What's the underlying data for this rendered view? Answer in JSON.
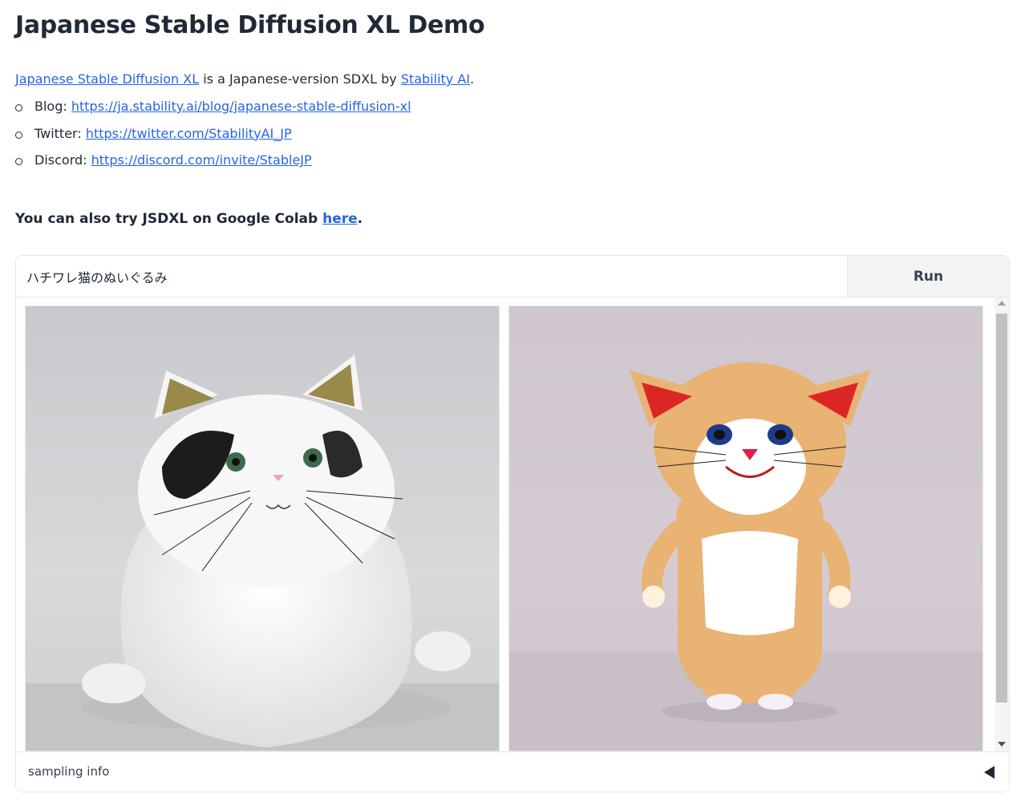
{
  "page": {
    "title": "Japanese Stable Diffusion XL Demo",
    "intro": {
      "link1_text": "Japanese Stable Diffusion XL",
      "middle_text": " is a Japanese-version SDXL by ",
      "link2_text": "Stability AI",
      "end_text": "."
    },
    "links": [
      {
        "label": "Blog: ",
        "url_text": "https://ja.stability.ai/blog/japanese-stable-diffusion-xl"
      },
      {
        "label": "Twitter: ",
        "url_text": "https://twitter.com/StabilityAI_JP"
      },
      {
        "label": "Discord: ",
        "url_text": "https://discord.com/invite/StableJP"
      }
    ],
    "colab": {
      "prefix": "You can also try JSDXL on Google Colab ",
      "link_text": "here",
      "suffix": "."
    }
  },
  "prompt": {
    "value": "ハチワレ猫のぬいぐるみ"
  },
  "run_button": {
    "label": "Run"
  },
  "gallery": {
    "images": [
      {
        "icon": "generated-image-white-cat-figure"
      },
      {
        "icon": "generated-image-orange-cat-plush"
      }
    ]
  },
  "sampling_info": {
    "label": "sampling info",
    "icon": "caret-left-icon"
  },
  "colors": {
    "link": "#2563eb",
    "text": "#1f2937",
    "button_bg": "#f3f4f6",
    "border": "#e5e7eb"
  }
}
